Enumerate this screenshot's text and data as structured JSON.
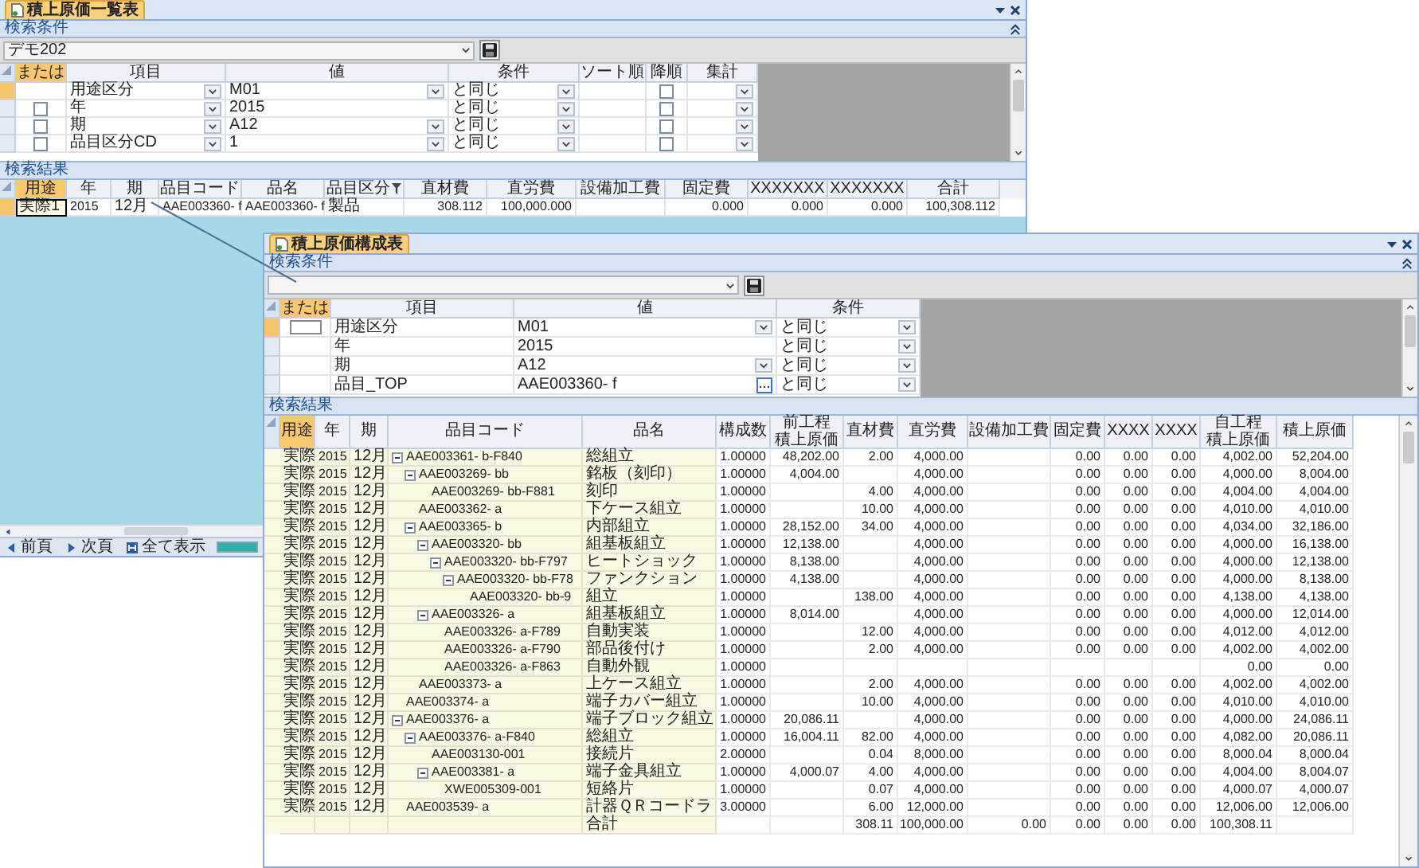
{
  "list_window": {
    "tab": "積上原価一覧表",
    "conditions_bar": "検索条件",
    "preset": "デモ202",
    "condition_columns": [
      {
        "label": "または",
        "current": true
      },
      {
        "label": "項目",
        "current": false
      },
      {
        "label": "値",
        "current": false
      },
      {
        "label": "条件",
        "current": false
      },
      {
        "label": "ソート順",
        "current": false
      },
      {
        "label": "降順",
        "current": false
      },
      {
        "label": "集計",
        "current": false
      }
    ],
    "conditions": [
      {
        "selected": true,
        "item": "用途区分",
        "item_dropdown": true,
        "value": "M01",
        "value_dropdown": true,
        "operator": "と同じ",
        "descending": false
      },
      {
        "selected": false,
        "or_checked": false,
        "item": "年",
        "item_dropdown": true,
        "value": "2015",
        "value_dropdown": false,
        "operator": "と同じ",
        "descending": false
      },
      {
        "selected": false,
        "or_checked": false,
        "item": "期",
        "item_dropdown": true,
        "value": "A12",
        "value_dropdown": true,
        "operator": "と同じ",
        "descending": false
      },
      {
        "selected": false,
        "or_checked": false,
        "item": "品目区分CD",
        "item_dropdown": true,
        "value": "1",
        "value_dropdown": true,
        "operator": "と同じ",
        "descending": false
      }
    ],
    "results_bar": "検索結果",
    "result_columns": [
      {
        "label": "用途",
        "current": true,
        "filter": false
      },
      {
        "label": "年",
        "current": false,
        "filter": false
      },
      {
        "label": "期",
        "current": false,
        "filter": false
      },
      {
        "label": "品目コード",
        "current": false,
        "filter": false
      },
      {
        "label": "品名",
        "current": false,
        "filter": false
      },
      {
        "label": "品目区分",
        "current": false,
        "filter": true
      },
      {
        "label": "直材費",
        "current": false,
        "filter": false
      },
      {
        "label": "直労費",
        "current": false,
        "filter": false
      },
      {
        "label": "設備加工費",
        "current": false,
        "filter": false
      },
      {
        "label": "固定費",
        "current": false,
        "filter": false
      },
      {
        "label": "XXXXXXX",
        "current": false,
        "filter": false
      },
      {
        "label": "XXXXXXX",
        "current": false,
        "filter": false
      },
      {
        "label": "合計",
        "current": false,
        "filter": false
      }
    ],
    "result_rows": [
      {
        "selected": true,
        "cells": {
          "use": "実際1",
          "year": "2015",
          "period": "12月",
          "code": "AAE003360- f",
          "name": "AAE003360- f",
          "category": "製品",
          "material": "308.112",
          "labor": "100,000.000",
          "fixed": "0.000",
          "column_11": "0.000",
          "column_12": "0.000",
          "total": "100,308.112"
        }
      }
    ],
    "nav": [
      {
        "kind": "prev",
        "label": "前頁"
      },
      {
        "kind": "next",
        "label": "次頁"
      },
      {
        "kind": "all",
        "label": "全て表示"
      }
    ],
    "progress": {
      "level": 1
    }
  },
  "detail_window": {
    "tab": "積上原価構成表",
    "conditions_bar": "検索条件",
    "condition_columns": [
      {
        "label": "または",
        "current": true
      },
      {
        "label": "項目",
        "current": false
      },
      {
        "label": "値",
        "current": false
      },
      {
        "label": "条件",
        "current": false
      }
    ],
    "conditions": [
      {
        "selected": true,
        "or_focused": true,
        "item": "用途区分",
        "value": "M01",
        "value_dropdown": true,
        "value_browse": false,
        "operator": "と同じ"
      },
      {
        "selected": false,
        "or_focused": false,
        "item": "年",
        "value": "2015",
        "value_dropdown": false,
        "value_browse": false,
        "operator": "と同じ"
      },
      {
        "selected": false,
        "or_focused": false,
        "item": "期",
        "value": "A12",
        "value_dropdown": true,
        "value_browse": false,
        "operator": "と同じ"
      },
      {
        "selected": false,
        "or_focused": false,
        "item": "品目_TOP",
        "value": "AAE003360- f",
        "value_dropdown": false,
        "value_browse": true,
        "operator": "と同じ"
      }
    ],
    "results_bar": "検索結果",
    "result_columns": [
      {
        "label": "用途",
        "current": true
      },
      {
        "label": "年",
        "current": false
      },
      {
        "label": "期",
        "current": false
      },
      {
        "label": "品目コード",
        "current": false
      },
      {
        "label": "品名",
        "current": false
      },
      {
        "label": "構成数",
        "current": false
      },
      {
        "prefix": "前工程",
        "label": "積上原価",
        "current": false
      },
      {
        "label": "直材費",
        "current": false
      },
      {
        "label": "直労費",
        "current": false
      },
      {
        "label": "設備加工費",
        "current": false
      },
      {
        "label": "固定費",
        "current": false
      },
      {
        "label": "XXXX",
        "current": false
      },
      {
        "label": "XXXX",
        "current": false
      },
      {
        "prefix": "自工程",
        "label": "積上原価",
        "current": false
      },
      {
        "label": "積上原価",
        "current": false
      }
    ],
    "tree": [
      {
        "use": "実際",
        "year": "2015",
        "period": "12月",
        "code": "AAE003361- b-F840",
        "name": "総組立",
        "expanded": true,
        "values": {
          "quantity": "1.00000",
          "prior_cost": "48,202.00",
          "material": "2.00",
          "labor": "4,000.00",
          "fixed": "0.00",
          "column_12": "0.00",
          "column_13": "0.00",
          "own_cost": "4,002.00",
          "total_cost": "52,204.00"
        },
        "children": [
          {
            "use": "実際",
            "year": "2015",
            "period": "12月",
            "code": "AAE003269- bb",
            "name": "銘板（刻印）",
            "expanded": true,
            "values": {
              "quantity": "1.00000",
              "prior_cost": "4,004.00",
              "labor": "4,000.00",
              "fixed": "0.00",
              "column_12": "0.00",
              "column_13": "0.00",
              "own_cost": "4,000.00",
              "total_cost": "8,004.00"
            },
            "children": [
              {
                "use": "実際",
                "year": "2015",
                "period": "12月",
                "code": "AAE003269- bb-F881",
                "name": "刻印",
                "values": {
                  "quantity": "1.00000",
                  "material": "4.00",
                  "labor": "4,000.00",
                  "fixed": "0.00",
                  "column_12": "0.00",
                  "column_13": "0.00",
                  "own_cost": "4,004.00",
                  "total_cost": "4,004.00"
                }
              }
            ]
          },
          {
            "use": "実際",
            "year": "2015",
            "period": "12月",
            "code": "AAE003362- a",
            "name": "下ケース組立",
            "values": {
              "quantity": "1.00000",
              "material": "10.00",
              "labor": "4,000.00",
              "fixed": "0.00",
              "column_12": "0.00",
              "column_13": "0.00",
              "own_cost": "4,010.00",
              "total_cost": "4,010.00"
            }
          },
          {
            "use": "実際",
            "year": "2015",
            "period": "12月",
            "code": "AAE003365- b",
            "name": "内部組立",
            "expanded": true,
            "values": {
              "quantity": "1.00000",
              "prior_cost": "28,152.00",
              "material": "34.00",
              "labor": "4,000.00",
              "fixed": "0.00",
              "column_12": "0.00",
              "column_13": "0.00",
              "own_cost": "4,034.00",
              "total_cost": "32,186.00"
            },
            "children": [
              {
                "use": "実際",
                "year": "2015",
                "period": "12月",
                "code": "AAE003320- bb",
                "name": "組基板組立",
                "expanded": true,
                "values": {
                  "quantity": "1.00000",
                  "prior_cost": "12,138.00",
                  "labor": "4,000.00",
                  "fixed": "0.00",
                  "column_12": "0.00",
                  "column_13": "0.00",
                  "own_cost": "4,000.00",
                  "total_cost": "16,138.00"
                },
                "children": [
                  {
                    "use": "実際",
                    "year": "2015",
                    "period": "12月",
                    "code": "AAE003320- bb-F797",
                    "name": "ヒートショック",
                    "expanded": true,
                    "values": {
                      "quantity": "1.00000",
                      "prior_cost": "8,138.00",
                      "labor": "4,000.00",
                      "fixed": "0.00",
                      "column_12": "0.00",
                      "column_13": "0.00",
                      "own_cost": "4,000.00",
                      "total_cost": "12,138.00"
                    },
                    "children": [
                      {
                        "use": "実際",
                        "year": "2015",
                        "period": "12月",
                        "code": "AAE003320- bb-F78",
                        "name": "ファンクション",
                        "expanded": true,
                        "values": {
                          "quantity": "1.00000",
                          "prior_cost": "4,138.00",
                          "labor": "4,000.00",
                          "fixed": "0.00",
                          "column_12": "0.00",
                          "column_13": "0.00",
                          "own_cost": "4,000.00",
                          "total_cost": "8,138.00"
                        },
                        "children": [
                          {
                            "use": "実際",
                            "year": "2015",
                            "period": "12月",
                            "code": "AAE003320- bb-9",
                            "name": "組立",
                            "values": {
                              "quantity": "1.00000",
                              "material": "138.00",
                              "labor": "4,000.00",
                              "fixed": "0.00",
                              "column_12": "0.00",
                              "column_13": "0.00",
                              "own_cost": "4,138.00",
                              "total_cost": "4,138.00"
                            }
                          }
                        ]
                      }
                    ]
                  }
                ]
              },
              {
                "use": "実際",
                "year": "2015",
                "period": "12月",
                "code": "AAE003326- a",
                "name": "組基板組立",
                "expanded": true,
                "values": {
                  "quantity": "1.00000",
                  "prior_cost": "8,014.00",
                  "labor": "4,000.00",
                  "fixed": "0.00",
                  "column_12": "0.00",
                  "column_13": "0.00",
                  "own_cost": "4,000.00",
                  "total_cost": "12,014.00"
                },
                "children": [
                  {
                    "use": "実際",
                    "year": "2015",
                    "period": "12月",
                    "code": "AAE003326- a-F789",
                    "name": "自動実装",
                    "values": {
                      "quantity": "1.00000",
                      "material": "12.00",
                      "labor": "4,000.00",
                      "fixed": "0.00",
                      "column_12": "0.00",
                      "column_13": "0.00",
                      "own_cost": "4,012.00",
                      "total_cost": "4,012.00"
                    }
                  },
                  {
                    "use": "実際",
                    "year": "2015",
                    "period": "12月",
                    "code": "AAE003326- a-F790",
                    "name": "部品後付け",
                    "values": {
                      "quantity": "1.00000",
                      "material": "2.00",
                      "labor": "4,000.00",
                      "fixed": "0.00",
                      "column_12": "0.00",
                      "column_13": "0.00",
                      "own_cost": "4,002.00",
                      "total_cost": "4,002.00"
                    }
                  },
                  {
                    "use": "実際",
                    "year": "2015",
                    "period": "12月",
                    "code": "AAE003326- a-F863",
                    "name": "自動外観",
                    "values": {
                      "quantity": "1.00000",
                      "own_cost": "0.00",
                      "total_cost": "0.00"
                    }
                  }
                ]
              }
            ]
          },
          {
            "use": "実際",
            "year": "2015",
            "period": "12月",
            "code": "AAE003373- a",
            "name": "上ケース組立",
            "values": {
              "quantity": "1.00000",
              "material": "2.00",
              "labor": "4,000.00",
              "fixed": "0.00",
              "column_12": "0.00",
              "column_13": "0.00",
              "own_cost": "4,002.00",
              "total_cost": "4,002.00"
            }
          }
        ]
      },
      {
        "use": "実際",
        "year": "2015",
        "period": "12月",
        "code": "AAE003374- a",
        "name": "端子カバー組立",
        "values": {
          "quantity": "1.00000",
          "material": "10.00",
          "labor": "4,000.00",
          "fixed": "0.00",
          "column_12": "0.00",
          "column_13": "0.00",
          "own_cost": "4,010.00",
          "total_cost": "4,010.00"
        }
      },
      {
        "use": "実際",
        "year": "2015",
        "period": "12月",
        "code": "AAE003376- a",
        "name": "端子ブロック組立",
        "expanded": true,
        "values": {
          "quantity": "1.00000",
          "prior_cost": "20,086.11",
          "labor": "4,000.00",
          "fixed": "0.00",
          "column_12": "0.00",
          "column_13": "0.00",
          "own_cost": "4,000.00",
          "total_cost": "24,086.11"
        },
        "children": [
          {
            "use": "実際",
            "year": "2015",
            "period": "12月",
            "code": "AAE003376- a-F840",
            "name": "総組立",
            "expanded": true,
            "values": {
              "quantity": "1.00000",
              "prior_cost": "16,004.11",
              "material": "82.00",
              "labor": "4,000.00",
              "fixed": "0.00",
              "column_12": "0.00",
              "column_13": "0.00",
              "own_cost": "4,082.00",
              "total_cost": "20,086.11"
            },
            "children": [
              {
                "use": "実際",
                "year": "2015",
                "period": "12月",
                "code": "AAE003130-001",
                "name": "接続片",
                "values": {
                  "quantity": "2.00000",
                  "material": "0.04",
                  "labor": "8,000.00",
                  "fixed": "0.00",
                  "column_12": "0.00",
                  "column_13": "0.00",
                  "own_cost": "8,000.04",
                  "total_cost": "8,000.04"
                }
              },
              {
                "use": "実際",
                "year": "2015",
                "period": "12月",
                "code": "AAE003381- a",
                "name": "端子金具組立",
                "expanded": true,
                "values": {
                  "quantity": "1.00000",
                  "prior_cost": "4,000.07",
                  "material": "4.00",
                  "labor": "4,000.00",
                  "fixed": "0.00",
                  "column_12": "0.00",
                  "column_13": "0.00",
                  "own_cost": "4,004.00",
                  "total_cost": "8,004.07"
                },
                "children": [
                  {
                    "use": "実際",
                    "year": "2015",
                    "period": "12月",
                    "code": "XWE005309-001",
                    "name": "短絡片",
                    "values": {
                      "quantity": "1.00000",
                      "material": "0.07",
                      "labor": "4,000.00",
                      "fixed": "0.00",
                      "column_12": "0.00",
                      "column_13": "0.00",
                      "own_cost": "4,000.07",
                      "total_cost": "4,000.07"
                    }
                  }
                ]
              }
            ]
          }
        ]
      },
      {
        "use": "実際",
        "year": "2015",
        "period": "12月",
        "code": "AAE003539- a",
        "name": "計器ＱＲコードラ",
        "values": {
          "quantity": "3.00000",
          "material": "6.00",
          "labor": "12,000.00",
          "fixed": "0.00",
          "column_12": "0.00",
          "column_13": "0.00",
          "own_cost": "12,006.00",
          "total_cost": "12,006.00"
        }
      }
    ],
    "total": {
      "name": "合計",
      "values": {
        "material": "308.11",
        "labor": "100,000.00",
        "equipment": "0.00",
        "fixed": "0.00",
        "column_12": "0.00",
        "column_13": "0.00",
        "own_cost": "100,308.11"
      }
    }
  }
}
